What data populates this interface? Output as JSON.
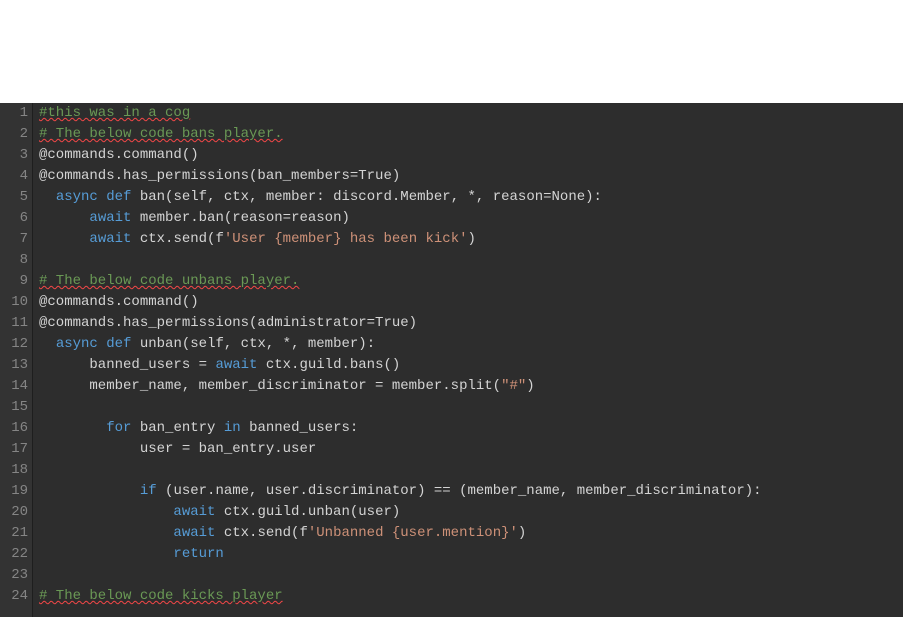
{
  "editor": {
    "lineCount": 24,
    "lines": [
      {
        "n": 1,
        "tokens": [
          {
            "cls": "tok-comment squiggle",
            "text": "#this was in a cog"
          }
        ]
      },
      {
        "n": 2,
        "tokens": [
          {
            "cls": "tok-comment squiggle",
            "text": "# The below code bans player."
          }
        ]
      },
      {
        "n": 3,
        "tokens": [
          {
            "cls": "tok-plain",
            "text": "@commands.command()"
          }
        ]
      },
      {
        "n": 4,
        "tokens": [
          {
            "cls": "tok-plain",
            "text": "@commands.has_permissions(ban_members=True)"
          }
        ]
      },
      {
        "n": 5,
        "tokens": [
          {
            "cls": "tok-plain",
            "text": "  "
          },
          {
            "cls": "tok-keyword",
            "text": "async"
          },
          {
            "cls": "tok-plain",
            "text": " "
          },
          {
            "cls": "tok-keyword",
            "text": "def"
          },
          {
            "cls": "tok-plain",
            "text": " ban(self, ctx, member: discord.Member, *, reason=None):"
          }
        ]
      },
      {
        "n": 6,
        "tokens": [
          {
            "cls": "tok-plain",
            "text": "      "
          },
          {
            "cls": "tok-await",
            "text": "await"
          },
          {
            "cls": "tok-plain",
            "text": " member.ban(reason=reason)"
          }
        ]
      },
      {
        "n": 7,
        "tokens": [
          {
            "cls": "tok-plain",
            "text": "      "
          },
          {
            "cls": "tok-await",
            "text": "await"
          },
          {
            "cls": "tok-plain",
            "text": " ctx.send(f"
          },
          {
            "cls": "tok-fstring",
            "text": "'User {member} has been kick'"
          },
          {
            "cls": "tok-plain",
            "text": ")"
          }
        ]
      },
      {
        "n": 8,
        "tokens": [
          {
            "cls": "tok-plain",
            "text": ""
          }
        ]
      },
      {
        "n": 9,
        "tokens": [
          {
            "cls": "tok-comment squiggle",
            "text": "# The below code unbans player."
          }
        ]
      },
      {
        "n": 10,
        "tokens": [
          {
            "cls": "tok-plain",
            "text": "@commands.command()"
          }
        ]
      },
      {
        "n": 11,
        "tokens": [
          {
            "cls": "tok-plain",
            "text": "@commands.has_permissions(administrator=True)"
          }
        ]
      },
      {
        "n": 12,
        "tokens": [
          {
            "cls": "tok-plain",
            "text": "  "
          },
          {
            "cls": "tok-keyword",
            "text": "async"
          },
          {
            "cls": "tok-plain",
            "text": " "
          },
          {
            "cls": "tok-keyword",
            "text": "def"
          },
          {
            "cls": "tok-plain",
            "text": " unban(self, ctx, *, member):"
          }
        ]
      },
      {
        "n": 13,
        "tokens": [
          {
            "cls": "tok-plain",
            "text": "      banned_users = "
          },
          {
            "cls": "tok-await",
            "text": "await"
          },
          {
            "cls": "tok-plain",
            "text": " ctx.guild.bans()"
          }
        ]
      },
      {
        "n": 14,
        "tokens": [
          {
            "cls": "tok-plain",
            "text": "      member_name, member_discriminator = member.split("
          },
          {
            "cls": "tok-string",
            "text": "\"#\""
          },
          {
            "cls": "tok-plain",
            "text": ")"
          }
        ]
      },
      {
        "n": 15,
        "tokens": [
          {
            "cls": "tok-plain",
            "text": ""
          }
        ]
      },
      {
        "n": 16,
        "tokens": [
          {
            "cls": "tok-plain",
            "text": "        "
          },
          {
            "cls": "tok-keyword",
            "text": "for"
          },
          {
            "cls": "tok-plain",
            "text": " ban_entry "
          },
          {
            "cls": "tok-keyword",
            "text": "in"
          },
          {
            "cls": "tok-plain",
            "text": " banned_users:"
          }
        ]
      },
      {
        "n": 17,
        "tokens": [
          {
            "cls": "tok-plain",
            "text": "            user = ban_entry.user"
          }
        ]
      },
      {
        "n": 18,
        "tokens": [
          {
            "cls": "tok-plain",
            "text": ""
          }
        ]
      },
      {
        "n": 19,
        "tokens": [
          {
            "cls": "tok-plain",
            "text": "            "
          },
          {
            "cls": "tok-keyword",
            "text": "if"
          },
          {
            "cls": "tok-plain",
            "text": " (user.name, user.discriminator) == (member_name, member_discriminator):"
          }
        ]
      },
      {
        "n": 20,
        "tokens": [
          {
            "cls": "tok-plain",
            "text": "                "
          },
          {
            "cls": "tok-await",
            "text": "await"
          },
          {
            "cls": "tok-plain",
            "text": " ctx.guild.unban(user)"
          }
        ]
      },
      {
        "n": 21,
        "tokens": [
          {
            "cls": "tok-plain",
            "text": "                "
          },
          {
            "cls": "tok-await",
            "text": "await"
          },
          {
            "cls": "tok-plain",
            "text": " ctx.send(f"
          },
          {
            "cls": "tok-fstring",
            "text": "'Unbanned {user.mention}'"
          },
          {
            "cls": "tok-plain",
            "text": ")"
          }
        ]
      },
      {
        "n": 22,
        "tokens": [
          {
            "cls": "tok-plain",
            "text": "                "
          },
          {
            "cls": "tok-keyword",
            "text": "return"
          }
        ]
      },
      {
        "n": 23,
        "tokens": [
          {
            "cls": "tok-plain",
            "text": ""
          }
        ]
      },
      {
        "n": 24,
        "tokens": [
          {
            "cls": "tok-comment squiggle",
            "text": "# The below code kicks player"
          }
        ]
      }
    ]
  }
}
